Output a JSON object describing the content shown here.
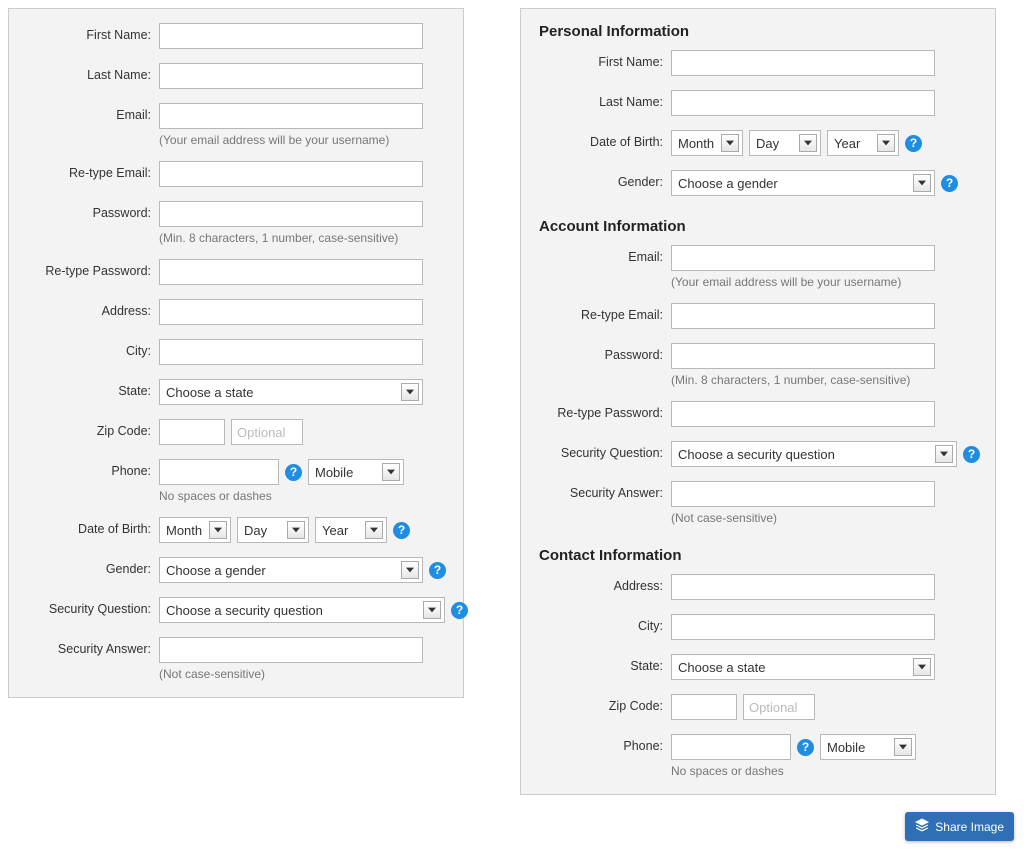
{
  "icons": {
    "help_glyph": "?"
  },
  "left": {
    "fields": {
      "first_name_label": "First Name:",
      "last_name_label": "Last Name:",
      "email_label": "Email:",
      "email_helper": "(Your email address will be your username)",
      "retype_email_label": "Re-type Email:",
      "password_label": "Password:",
      "password_helper": "(Min. 8 characters, 1 number, case-sensitive)",
      "retype_password_label": "Re-type Password:",
      "address_label": "Address:",
      "city_label": "City:",
      "state_label": "State:",
      "state_value": "Choose a state",
      "zip_label": "Zip Code:",
      "zip_optional_placeholder": "Optional",
      "phone_label": "Phone:",
      "phone_helper": "No spaces or dashes",
      "phone_type_value": "Mobile",
      "dob_label": "Date of Birth:",
      "dob_month": "Month",
      "dob_day": "Day",
      "dob_year": "Year",
      "gender_label": "Gender:",
      "gender_value": "Choose a gender",
      "security_q_label": "Security Question:",
      "security_q_value": "Choose a security question",
      "security_a_label": "Security Answer:",
      "security_a_helper": "(Not case-sensitive)"
    }
  },
  "right": {
    "personal": {
      "heading": "Personal Information",
      "first_name_label": "First Name:",
      "last_name_label": "Last Name:",
      "dob_label": "Date of Birth:",
      "dob_month": "Month",
      "dob_day": "Day",
      "dob_year": "Year",
      "gender_label": "Gender:",
      "gender_value": "Choose a gender"
    },
    "account": {
      "heading": "Account Information",
      "email_label": "Email:",
      "email_helper": "(Your email address will be your username)",
      "retype_email_label": "Re-type Email:",
      "password_label": "Password:",
      "password_helper": "(Min. 8 characters, 1 number, case-sensitive)",
      "retype_password_label": "Re-type Password:",
      "security_q_label": "Security Question:",
      "security_q_value": "Choose a security question",
      "security_a_label": "Security Answer:",
      "security_a_helper": "(Not case-sensitive)"
    },
    "contact": {
      "heading": "Contact Information",
      "address_label": "Address:",
      "city_label": "City:",
      "state_label": "State:",
      "state_value": "Choose a state",
      "zip_label": "Zip Code:",
      "zip_optional_placeholder": "Optional",
      "phone_label": "Phone:",
      "phone_helper": "No spaces or dashes",
      "phone_type_value": "Mobile"
    }
  },
  "share_button_label": "Share Image"
}
